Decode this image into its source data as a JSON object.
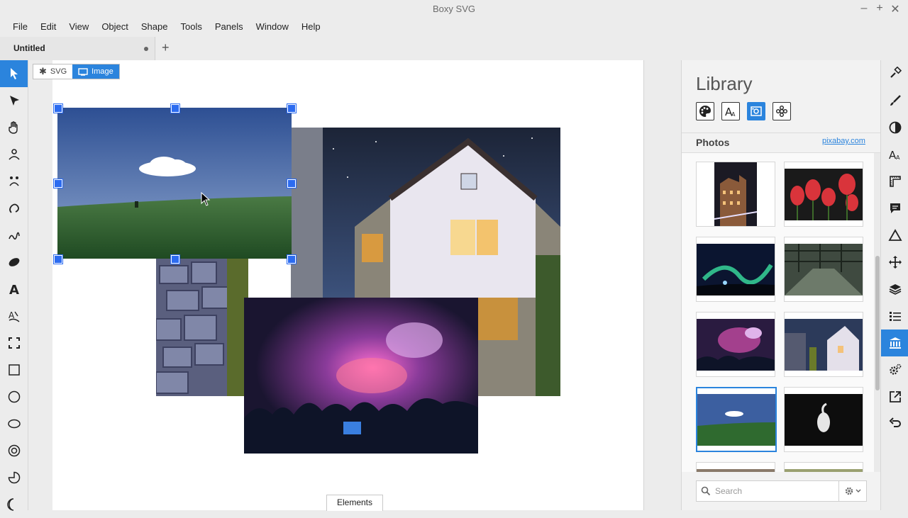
{
  "window": {
    "title": "Boxy SVG",
    "controls": [
      "–",
      "+",
      "✕"
    ]
  },
  "menu": [
    "File",
    "Edit",
    "View",
    "Object",
    "Shape",
    "Tools",
    "Panels",
    "Window",
    "Help"
  ],
  "tabs": {
    "active_label": "Untitled",
    "new_tab": "+"
  },
  "canvas": {
    "mode_svg": "SVG",
    "mode_image": "Image",
    "elements_button": "Elements"
  },
  "library": {
    "title": "Library",
    "section_label": "Photos",
    "source_link": "pixabay.com",
    "search_placeholder": "Search",
    "thumbnails": [
      "city-night",
      "red-tulips",
      "aurora",
      "abandoned-greenhouse",
      "fireworks-crowd",
      "timber-house-night",
      "green-field-cloud",
      "white-heron"
    ],
    "selected_thumbnail": "green-field-cloud"
  },
  "left_tools": [
    "pointer-icon",
    "arrow-icon",
    "hand-icon",
    "person-icon",
    "face-icon",
    "lasso-icon",
    "freehand-icon",
    "blob-icon",
    "text-icon",
    "text-path-icon",
    "crop-icon",
    "rectangle-icon",
    "circle-icon",
    "ellipse-icon",
    "ring-icon",
    "pie-icon",
    "crescent-icon"
  ],
  "right_tools": [
    "paint-roller-icon",
    "brush-icon",
    "contrast-icon",
    "font-icon",
    "ruler-icon",
    "comment-icon",
    "triangle-icon",
    "move-icon",
    "layers-icon",
    "list-icon",
    "library-icon",
    "settings-icon",
    "export-icon",
    "undo-icon"
  ],
  "colors": {
    "accent": "#2b84dd",
    "handle": "#2b6bf0"
  }
}
